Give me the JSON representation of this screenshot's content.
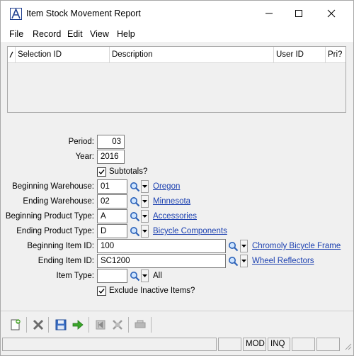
{
  "window": {
    "title": "Item Stock Movement Report"
  },
  "menu": [
    "File",
    "Record",
    "Edit",
    "View",
    "Help"
  ],
  "grid": {
    "columns": [
      {
        "label": "Selection ID"
      },
      {
        "label": "Description"
      },
      {
        "label": "User ID"
      },
      {
        "label": "Pri?"
      }
    ],
    "rows": []
  },
  "form": {
    "period": {
      "label": "Period:",
      "value": "03"
    },
    "year": {
      "label": "Year:",
      "value": "2016"
    },
    "subtotals": {
      "label": "Subtotals?",
      "checked": true
    },
    "beginning_warehouse": {
      "label": "Beginning Warehouse:",
      "value": "01",
      "description": "Oregon"
    },
    "ending_warehouse": {
      "label": "Ending Warehouse:",
      "value": "02",
      "description": "Minnesota"
    },
    "beginning_product_type": {
      "label": "Beginning Product Type:",
      "value": "A",
      "description": "Accessories"
    },
    "ending_product_type": {
      "label": "Ending Product Type:",
      "value": "D",
      "description": "Bicycle Components"
    },
    "beginning_item_id": {
      "label": "Beginning Item ID:",
      "value": "100",
      "description": "Chromoly Bicycle Frame"
    },
    "ending_item_id": {
      "label": "Ending Item ID:",
      "value": "SC1200",
      "description": "Wheel Reflectors"
    },
    "item_type": {
      "label": "Item Type:",
      "value": "",
      "description": "All"
    },
    "exclude_inactive": {
      "label": "Exclude Inactive Items?",
      "checked": true
    }
  },
  "status": {
    "mode1": "MOD",
    "mode2": "INQ"
  },
  "toolbar_icons": [
    "new-record-icon",
    "delete-icon",
    "save-icon",
    "proceed-arrow-icon",
    "first-record-icon",
    "clear-icon",
    "print-icon"
  ]
}
